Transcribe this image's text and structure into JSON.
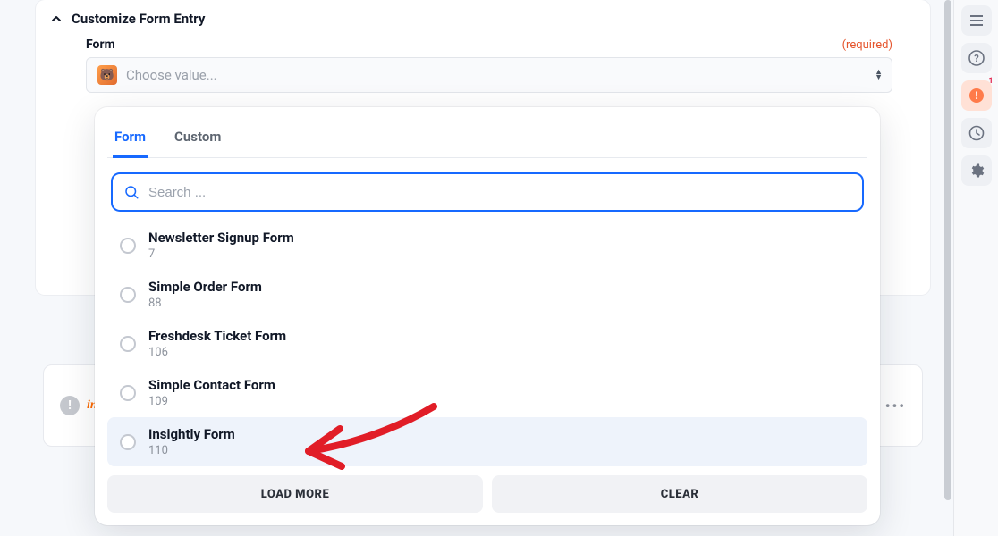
{
  "section": {
    "title": "Customize Form Entry"
  },
  "field": {
    "label": "Form",
    "required_text": "(required)",
    "placeholder": "Choose value..."
  },
  "dropdown": {
    "tabs": {
      "form": "Form",
      "custom": "Custom"
    },
    "search_placeholder": "Search ...",
    "options": [
      {
        "title": "Newsletter Signup Form",
        "id": "7"
      },
      {
        "title": "Simple Order Form",
        "id": "88"
      },
      {
        "title": "Freshdesk Ticket Form",
        "id": "106"
      },
      {
        "title": "Simple Contact Form",
        "id": "109"
      },
      {
        "title": "Insightly Form",
        "id": "110"
      }
    ],
    "load_more": "LOAD MORE",
    "clear": "CLEAR"
  },
  "bg_step": {
    "logo_text": "insig",
    "dots": "•••"
  },
  "rail": {
    "warn_badge": "1"
  }
}
